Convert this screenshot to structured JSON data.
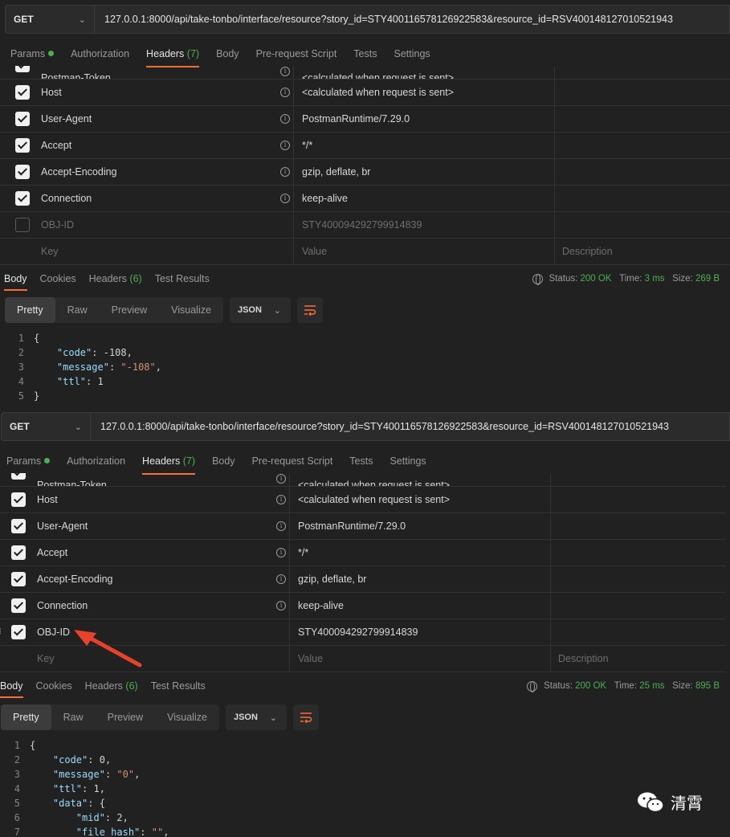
{
  "panel1": {
    "method": "GET",
    "url": "127.0.0.1:8000/api/take-tonbo/interface/resource?story_id=STY400116578126922583&resource_id=RSV400148127010521943",
    "tabs": [
      "Params",
      "Authorization",
      "Headers",
      "(7)",
      "Body",
      "Pre-request Script",
      "Tests",
      "Settings"
    ],
    "headers": [
      {
        "key": "Postman-Token",
        "value": "<calculated when request is sent>",
        "checked": true
      },
      {
        "key": "Host",
        "value": "<calculated when request is sent>",
        "checked": true
      },
      {
        "key": "User-Agent",
        "value": "PostmanRuntime/7.29.0",
        "checked": true
      },
      {
        "key": "Accept",
        "value": "*/*",
        "checked": true
      },
      {
        "key": "Accept-Encoding",
        "value": "gzip, deflate, br",
        "checked": true
      },
      {
        "key": "Connection",
        "value": "keep-alive",
        "checked": true
      },
      {
        "key": "OBJ-ID",
        "value": "STY400094292799914839",
        "checked": false
      }
    ],
    "placeholder": {
      "key": "Key",
      "value": "Value",
      "description": "Description"
    },
    "resp_tabs": [
      "Body",
      "Cookies",
      "Headers",
      "(6)",
      "Test Results"
    ],
    "status": {
      "label_status": "Status:",
      "status": "200 OK",
      "label_time": "Time:",
      "time": "3 ms",
      "label_size": "Size:",
      "size": "269 B"
    },
    "formats": [
      "Pretty",
      "Raw",
      "Preview",
      "Visualize"
    ],
    "lang": "JSON",
    "lines": [
      "1",
      "2",
      "3",
      "4",
      "5"
    ],
    "json": {
      "code_key": "\"code\"",
      "code_val": "-108",
      "message_key": "\"message\"",
      "message_val": "\"-108\"",
      "ttl_key": "\"ttl\"",
      "ttl_val": "1"
    }
  },
  "panel2": {
    "method": "GET",
    "url": "127.0.0.1:8000/api/take-tonbo/interface/resource?story_id=STY400116578126922583&resource_id=RSV400148127010521943",
    "tabs": [
      "Params",
      "Authorization",
      "Headers",
      "(7)",
      "Body",
      "Pre-request Script",
      "Tests",
      "Settings"
    ],
    "headers": [
      {
        "key": "Postman-Token",
        "value": "<calculated when request is sent>",
        "checked": true
      },
      {
        "key": "Host",
        "value": "<calculated when request is sent>",
        "checked": true
      },
      {
        "key": "User-Agent",
        "value": "PostmanRuntime/7.29.0",
        "checked": true
      },
      {
        "key": "Accept",
        "value": "*/*",
        "checked": true
      },
      {
        "key": "Accept-Encoding",
        "value": "gzip, deflate, br",
        "checked": true
      },
      {
        "key": "Connection",
        "value": "keep-alive",
        "checked": true
      },
      {
        "key": "OBJ-ID",
        "value": "STY400094292799914839",
        "checked": true
      }
    ],
    "placeholder": {
      "key": "Key",
      "value": "Value",
      "description": "Description"
    },
    "resp_tabs": [
      "Body",
      "Cookies",
      "Headers",
      "(6)",
      "Test Results"
    ],
    "status": {
      "label_status": "Status:",
      "status": "200 OK",
      "label_time": "Time:",
      "time": "25 ms",
      "label_size": "Size:",
      "size": "895 B"
    },
    "formats": [
      "Pretty",
      "Raw",
      "Preview",
      "Visualize"
    ],
    "lang": "JSON",
    "lines": [
      "1",
      "2",
      "3",
      "4",
      "5",
      "6",
      "7"
    ],
    "json": {
      "code_key": "\"code\"",
      "code_val": "0",
      "message_key": "\"message\"",
      "message_val": "\"0\"",
      "ttl_key": "\"ttl\"",
      "ttl_val": "1",
      "data_key": "\"data\"",
      "mid_key": "\"mid\"",
      "mid_val": "2",
      "hash_key": "\"file_hash\"",
      "hash_val": "\"\""
    }
  },
  "watermark": {
    "text": "清霄"
  },
  "colors": {
    "accent": "#ff6c37",
    "ok": "#4caf50",
    "json_key": "#9cdcfe",
    "json_string": "#ce9178"
  }
}
